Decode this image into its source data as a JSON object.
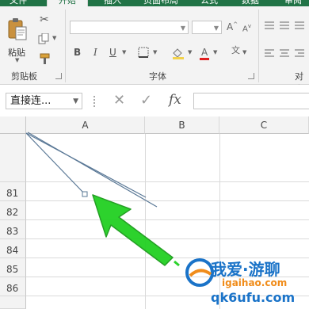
{
  "ribbon": {
    "tabs": [
      {
        "label": "文件",
        "active": false
      },
      {
        "label": "开始",
        "active": true
      },
      {
        "label": "插入",
        "active": false
      },
      {
        "label": "页面布局",
        "active": false
      },
      {
        "label": "公式",
        "active": false
      },
      {
        "label": "数据",
        "active": false
      },
      {
        "label": "审阅",
        "active": false
      }
    ],
    "clipboard": {
      "paste_label": "粘贴",
      "group_label": "剪贴板"
    },
    "font": {
      "group_label": "字体"
    },
    "align": {
      "group_label": "对齐"
    },
    "bold": "B",
    "italic": "I",
    "underline": "U",
    "font_color_letter": "A"
  },
  "formula_bar": {
    "name_box_value": "直接连...",
    "cancel_symbol": "✕",
    "enter_symbol": "✓",
    "fx_label": "fx",
    "formula_value": ""
  },
  "sheet": {
    "columns": [
      "A",
      "B",
      "C"
    ],
    "rows": [
      "81",
      "82",
      "83",
      "84",
      "85",
      "86"
    ]
  },
  "annotation": {
    "arrow_color": "#22cc22"
  },
  "watermark": {
    "line1": "我爱·游聊",
    "line2": "igaihao.com",
    "line3": "qk6ufu.com",
    "brand_color": "#1a73c8",
    "accent_color": "#f08c1a"
  },
  "theme": {
    "accent": "#217346"
  }
}
